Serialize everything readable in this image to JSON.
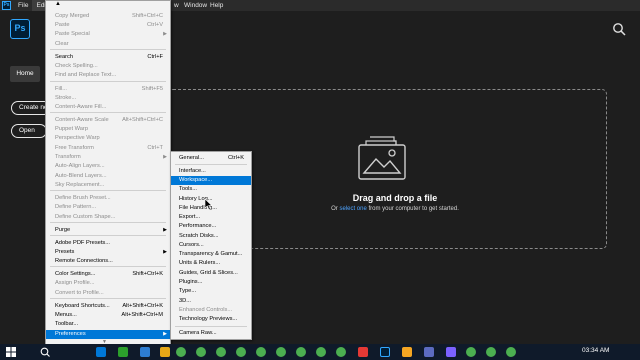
{
  "menubar": {
    "app_icon": "Ps",
    "items": [
      "File",
      "Edit",
      "Window",
      "Help"
    ],
    "partial_item": "w"
  },
  "app": {
    "logo": "Ps"
  },
  "sidebar": {
    "home_label": "Home",
    "create_label": "Create ne",
    "open_label": "Open"
  },
  "dropzone": {
    "title": "Drag and drop a file",
    "sub_prefix": "Or ",
    "sub_link": "select one",
    "sub_suffix": " from your computer to get started."
  },
  "edit_menu": {
    "items": [
      {
        "label": "Copy Merged",
        "shortcut": "Shift+Ctrl+C",
        "disabled": true
      },
      {
        "label": "Paste",
        "shortcut": "Ctrl+V",
        "disabled": true
      },
      {
        "label": "Paste Special",
        "shortcut": "",
        "disabled": true,
        "submenu": true
      },
      {
        "label": "Clear",
        "shortcut": "",
        "disabled": true
      },
      {
        "label": "Search",
        "shortcut": "Ctrl+F",
        "disabled": false
      },
      {
        "label": "Check Spelling...",
        "shortcut": "",
        "disabled": true
      },
      {
        "label": "Find and Replace Text...",
        "shortcut": "",
        "disabled": true
      },
      {
        "label": "Fill...",
        "shortcut": "Shift+F5",
        "disabled": true
      },
      {
        "label": "Stroke...",
        "shortcut": "",
        "disabled": true
      },
      {
        "label": "Content-Aware Fill...",
        "shortcut": "",
        "disabled": true
      },
      {
        "label": "Content-Aware Scale",
        "shortcut": "Alt+Shift+Ctrl+C",
        "disabled": true
      },
      {
        "label": "Puppet Warp",
        "shortcut": "",
        "disabled": true
      },
      {
        "label": "Perspective Warp",
        "shortcut": "",
        "disabled": true
      },
      {
        "label": "Free Transform",
        "shortcut": "Ctrl+T",
        "disabled": true
      },
      {
        "label": "Transform",
        "shortcut": "",
        "disabled": true,
        "submenu": true
      },
      {
        "label": "Auto-Align Layers...",
        "shortcut": "",
        "disabled": true
      },
      {
        "label": "Auto-Blend Layers...",
        "shortcut": "",
        "disabled": true
      },
      {
        "label": "Sky Replacement...",
        "shortcut": "",
        "disabled": true
      },
      {
        "label": "Define Brush Preset...",
        "shortcut": "",
        "disabled": true
      },
      {
        "label": "Define Pattern...",
        "shortcut": "",
        "disabled": true
      },
      {
        "label": "Define Custom Shape...",
        "shortcut": "",
        "disabled": true
      },
      {
        "label": "Purge",
        "shortcut": "",
        "disabled": false,
        "submenu": true
      },
      {
        "label": "Adobe PDF Presets...",
        "shortcut": "",
        "disabled": false
      },
      {
        "label": "Presets",
        "shortcut": "",
        "disabled": false,
        "submenu": true
      },
      {
        "label": "Remote Connections...",
        "shortcut": "",
        "disabled": false
      },
      {
        "label": "Color Settings...",
        "shortcut": "Shift+Ctrl+K",
        "disabled": false
      },
      {
        "label": "Assign Profile...",
        "shortcut": "",
        "disabled": true
      },
      {
        "label": "Convert to Profile...",
        "shortcut": "",
        "disabled": true
      },
      {
        "label": "Keyboard Shortcuts...",
        "shortcut": "Alt+Shift+Ctrl+K",
        "disabled": false
      },
      {
        "label": "Menus...",
        "shortcut": "Alt+Shift+Ctrl+M",
        "disabled": false
      },
      {
        "label": "Toolbar...",
        "shortcut": "",
        "disabled": false
      },
      {
        "label": "Preferences",
        "shortcut": "",
        "disabled": false,
        "submenu": true,
        "highlighted": true
      }
    ]
  },
  "preferences_menu": {
    "items": [
      {
        "label": "General...",
        "shortcut": "Ctrl+K"
      },
      {
        "label": "Interface...",
        "shortcut": ""
      },
      {
        "label": "Workspace...",
        "shortcut": "",
        "highlighted": true
      },
      {
        "label": "Tools...",
        "shortcut": ""
      },
      {
        "label": "History Log...",
        "shortcut": ""
      },
      {
        "label": "File Handling...",
        "shortcut": ""
      },
      {
        "label": "Export...",
        "shortcut": ""
      },
      {
        "label": "Performance...",
        "shortcut": ""
      },
      {
        "label": "Scratch Disks...",
        "shortcut": ""
      },
      {
        "label": "Cursors...",
        "shortcut": ""
      },
      {
        "label": "Transparency & Gamut...",
        "shortcut": ""
      },
      {
        "label": "Units & Rulers...",
        "shortcut": ""
      },
      {
        "label": "Guides, Grid & Slices...",
        "shortcut": ""
      },
      {
        "label": "Plugins...",
        "shortcut": ""
      },
      {
        "label": "Type...",
        "shortcut": ""
      },
      {
        "label": "3D...",
        "shortcut": ""
      },
      {
        "label": "Enhanced Controls...",
        "shortcut": "",
        "disabled": true
      },
      {
        "label": "Technology Previews...",
        "shortcut": ""
      },
      {
        "label": "Camera Raw...",
        "shortcut": ""
      }
    ]
  },
  "taskbar": {
    "time": "03:34 AM"
  },
  "colors": {
    "accent": "#0078d7",
    "ps_blue": "#31a8ff",
    "link": "#4da3ff"
  }
}
